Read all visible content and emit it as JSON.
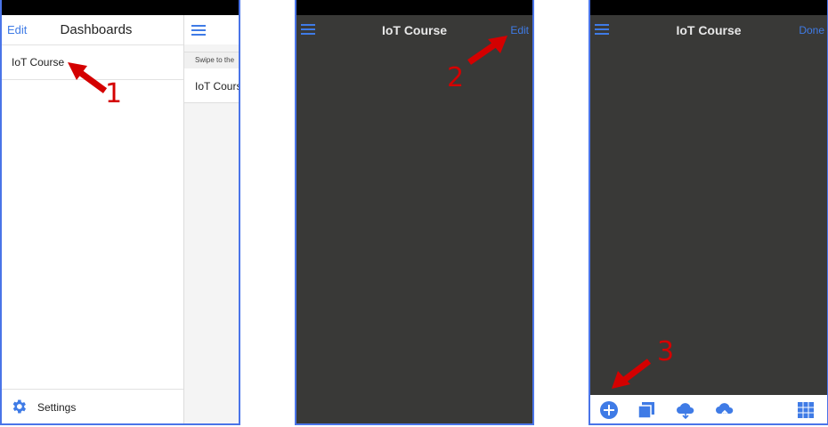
{
  "screen1": {
    "edit_label": "Edit",
    "title": "Dashboards",
    "row_label": "IoT Course",
    "settings_label": "Settings",
    "hint_text": "Swipe to the",
    "item_label": "IoT Cours"
  },
  "screen2": {
    "title": "IoT Course",
    "edit_label": "Edit"
  },
  "screen3": {
    "title": "IoT Course",
    "done_label": "Done",
    "toolbar_icons": [
      "add-icon",
      "copy-icon",
      "cloud-download-icon",
      "cloud-upload-icon",
      "grid-icon"
    ]
  },
  "annotations": {
    "step1": "1",
    "step2": "2",
    "step3": "3"
  },
  "colors": {
    "accent": "#3f7be6",
    "dark_background": "#393937",
    "frame_border": "#4a74e8",
    "annotation_red": "#d40000"
  }
}
